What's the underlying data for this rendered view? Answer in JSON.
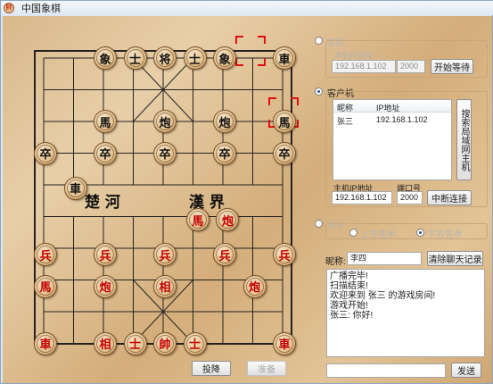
{
  "window": {
    "title": "中国象棋",
    "icon": "chess-app-icon"
  },
  "board": {
    "river_left": "楚  河",
    "river_right": "漢  界",
    "pieces": [
      {
        "t": "象",
        "c": "black"
      },
      {
        "t": "士",
        "c": "black"
      },
      {
        "t": "将",
        "c": "black"
      },
      {
        "t": "士",
        "c": "black"
      },
      {
        "t": "象",
        "c": "black"
      },
      {
        "t": "車",
        "c": "black"
      },
      {
        "t": "馬",
        "c": "black"
      },
      {
        "t": "炮",
        "c": "black"
      },
      {
        "t": "炮",
        "c": "black"
      },
      {
        "t": "馬",
        "c": "black"
      },
      {
        "t": "卒",
        "c": "black"
      },
      {
        "t": "卒",
        "c": "black"
      },
      {
        "t": "卒",
        "c": "black"
      },
      {
        "t": "卒",
        "c": "black"
      },
      {
        "t": "卒",
        "c": "black"
      },
      {
        "t": "車",
        "c": "black"
      },
      {
        "t": "馬",
        "c": "red"
      },
      {
        "t": "炮",
        "c": "red"
      },
      {
        "t": "兵",
        "c": "red"
      },
      {
        "t": "兵",
        "c": "red"
      },
      {
        "t": "兵",
        "c": "red"
      },
      {
        "t": "兵",
        "c": "red"
      },
      {
        "t": "兵",
        "c": "red"
      },
      {
        "t": "馬",
        "c": "red"
      },
      {
        "t": "炮",
        "c": "red"
      },
      {
        "t": "相",
        "c": "red"
      },
      {
        "t": "炮",
        "c": "red"
      },
      {
        "t": "車",
        "c": "red"
      },
      {
        "t": "相",
        "c": "red"
      },
      {
        "t": "士",
        "c": "red"
      },
      {
        "t": "帥",
        "c": "red"
      },
      {
        "t": "士",
        "c": "red"
      },
      {
        "t": "車",
        "c": "red"
      }
    ]
  },
  "host_panel": {
    "label": "主机",
    "ip_label": "本机IP地址",
    "ip_value": "192.168.1.102",
    "port_value": "2000",
    "start_button": "开始等待"
  },
  "client_panel": {
    "label": "客户机",
    "columns": [
      "昵称",
      "IP地址"
    ],
    "rows": [
      [
        "张三",
        "192.168.1.102"
      ]
    ],
    "search_button": "搜索局域网主机",
    "host_ip_label": "主机IP地址",
    "port_label": "端口号",
    "host_ip_value": "192.168.1.102",
    "port_value": "2000",
    "disconnect_button": "中断连接"
  },
  "first_move": {
    "label": "先手",
    "option_top": "上方先手",
    "option_bottom": "下方先手"
  },
  "chat": {
    "nickname_label": "昵称:",
    "nickname_value": "李四",
    "clear_button": "清除聊天记录",
    "messages": [
      "广播完毕!",
      "扫描结束!",
      "欢迎来到 张三 的游戏房间!",
      "游戏开始!",
      "张三: 你好!"
    ],
    "input_value": "",
    "send_button": "发送"
  },
  "game_buttons": {
    "resign": "投降",
    "ready": "准备"
  }
}
